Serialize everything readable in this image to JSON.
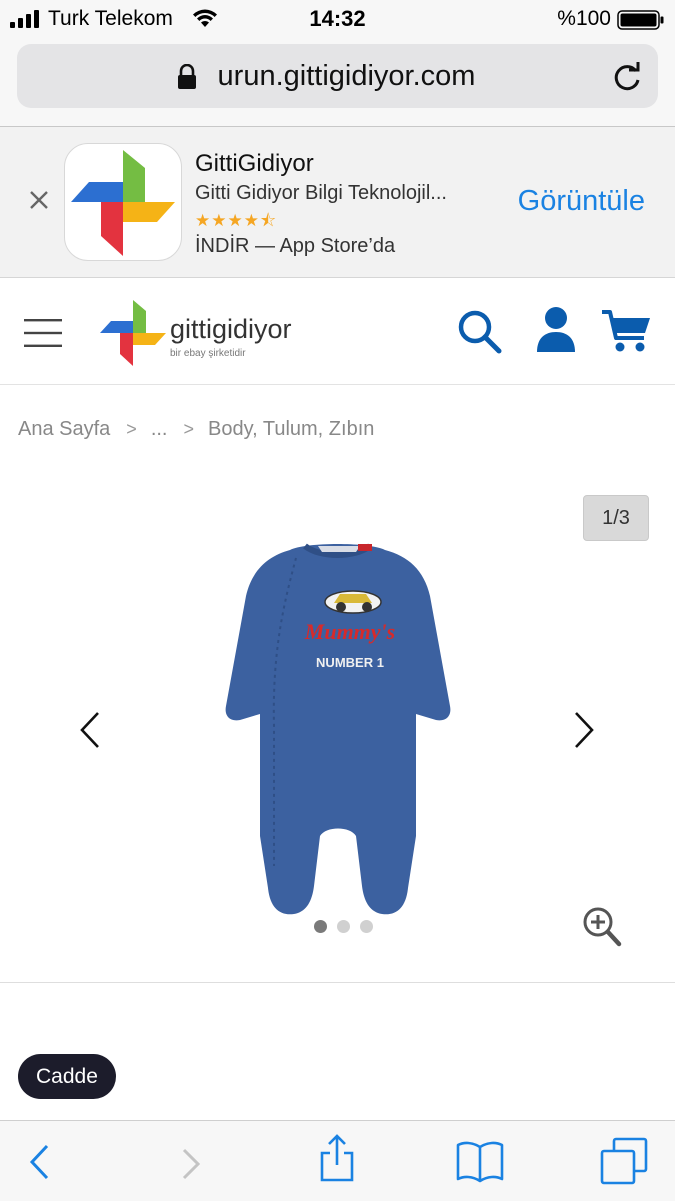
{
  "status_bar": {
    "carrier": "Turk Telekom",
    "time": "14:32",
    "battery": "%100"
  },
  "browser": {
    "url": "urun.gittigidiyor.com"
  },
  "app_banner": {
    "name": "GittiGidiyor",
    "publisher": "Gitti Gidiyor Bilgi Teknolojil...",
    "stars": "★★★★⯪",
    "install_text": "İNDİR — App Store’da",
    "view_label": "Görüntüle"
  },
  "header": {
    "logo_text": "gittigidiyor",
    "logo_sub": "bir ebay şirketidir"
  },
  "breadcrumb": {
    "items": [
      "Ana Sayfa",
      "...",
      "Body, Tulum, Zıbın"
    ],
    "separator": ">"
  },
  "gallery": {
    "counter": "1/3",
    "current_index": 1,
    "total": 3,
    "product_print_line1": "Mummy's",
    "product_print_line2": "NUMBER 1"
  },
  "chip": {
    "label": "Cadde"
  },
  "colors": {
    "link_blue": "#1a82e2",
    "brand_blue": "#0b5cad",
    "chip_bg": "#1c1c2b",
    "onesie_blue": "#3c61a0"
  }
}
